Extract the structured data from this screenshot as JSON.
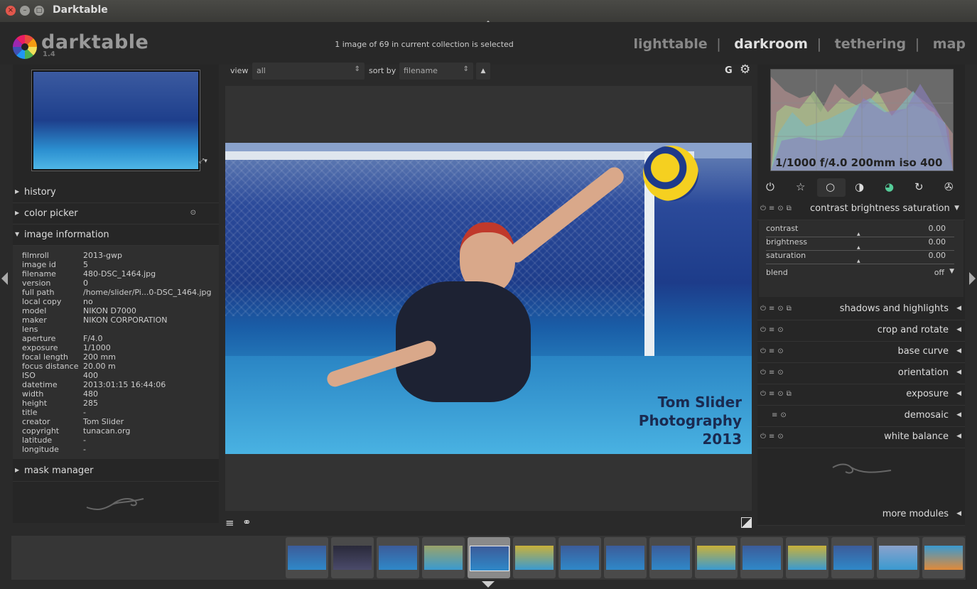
{
  "window": {
    "title": "Darktable",
    "close": "×",
    "minimize": "–",
    "maximize": "□"
  },
  "app": {
    "logo": "darktable",
    "version": "1.4",
    "status": "1 image of 69 in current collection is selected"
  },
  "views": {
    "items": [
      "lighttable",
      "darkroom",
      "tethering",
      "map"
    ],
    "active": "darkroom",
    "separator": "|"
  },
  "toolbar": {
    "view_label": "view",
    "view_value": "all",
    "sort_label": "sort by",
    "sort_value": "filename",
    "sort_dir": "▲",
    "g_label": "G",
    "gear": "⚙"
  },
  "left": {
    "sections": {
      "history": "history",
      "color_picker": "color picker",
      "image_information": "image information",
      "mask_manager": "mask manager"
    },
    "image_info": [
      {
        "k": "filmroll",
        "v": "2013-gwp"
      },
      {
        "k": "image id",
        "v": "5"
      },
      {
        "k": "filename",
        "v": "480-DSC_1464.jpg"
      },
      {
        "k": "version",
        "v": "0"
      },
      {
        "k": "full path",
        "v": "/home/slider/Pi...0-DSC_1464.jpg"
      },
      {
        "k": "local copy",
        "v": "no"
      },
      {
        "k": "model",
        "v": "NIKON D7000"
      },
      {
        "k": "maker",
        "v": "NIKON CORPORATION"
      },
      {
        "k": "lens",
        "v": ""
      },
      {
        "k": "aperture",
        "v": "F/4.0"
      },
      {
        "k": "exposure",
        "v": "1/1000"
      },
      {
        "k": "focal length",
        "v": "200 mm"
      },
      {
        "k": "focus distance",
        "v": "20.00 m"
      },
      {
        "k": "ISO",
        "v": "400"
      },
      {
        "k": "datetime",
        "v": "2013:01:15 16:44:06"
      },
      {
        "k": "width",
        "v": "480"
      },
      {
        "k": "height",
        "v": "285"
      },
      {
        "k": "title",
        "v": "-"
      },
      {
        "k": "creator",
        "v": "Tom Slider"
      },
      {
        "k": "copyright",
        "v": "tunacan.org"
      },
      {
        "k": "latitude",
        "v": "-"
      },
      {
        "k": "longitude",
        "v": "-"
      }
    ]
  },
  "photo": {
    "watermark": [
      "Tom Slider",
      "Photography",
      "2013"
    ]
  },
  "right": {
    "histogram_exif": "1/1000 f/4.0 200mm iso 400",
    "group_icons": [
      "power-icon",
      "star-icon",
      "circle-icon",
      "half-circle-icon",
      "color-wheel-icon",
      "rotate-icon",
      "film-icon"
    ],
    "expanded_module": {
      "name": "contrast brightness saturation",
      "sliders": [
        {
          "label": "contrast",
          "value": "0.00"
        },
        {
          "label": "brightness",
          "value": "0.00"
        },
        {
          "label": "saturation",
          "value": "0.00"
        }
      ],
      "blend_label": "blend",
      "blend_value": "off"
    },
    "modules": [
      "shadows and highlights",
      "crop and rotate",
      "base curve",
      "orientation",
      "exposure",
      "demosaic",
      "white balance"
    ],
    "more_modules": "more modules"
  },
  "colors": {
    "bg": "#2a2a2a",
    "panel": "#262626",
    "text": "#cccccc"
  }
}
